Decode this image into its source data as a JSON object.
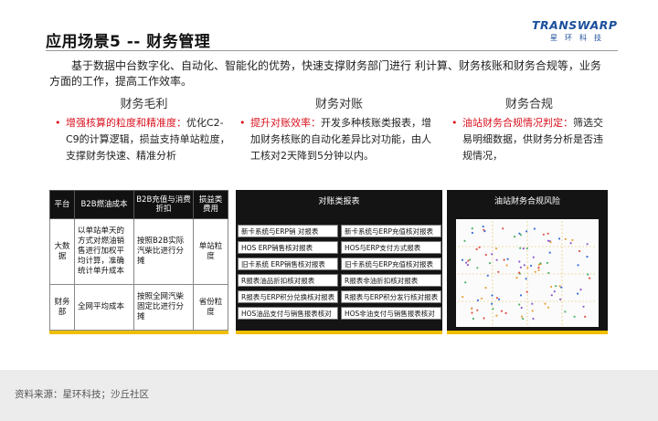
{
  "header": {
    "title": "应用场景5 -- 财务管理",
    "logo_brand": "TRANSWARP",
    "logo_sub": "星环科技"
  },
  "intro": "基于数据中台数字化、自动化、智能化的优势，快速支撑财务部门进行 利计算、财务核账和财务合规等，业务方面的工作，提高工作效率。",
  "columns": [
    {
      "heading": "财务毛利",
      "highlight": "增强核算的粒度和精准度：",
      "text": "优化C2-C9的计算逻辑，损益支持单站粒度，支撑财务快速、精准分析"
    },
    {
      "heading": "财务对账",
      "highlight": "提升对账效率：",
      "text": "开发多种核账类报表，增加财务核账的自动化差异比对功能，由人工核对2天降到5分钟以内。"
    },
    {
      "heading": "财务合规",
      "highlight": "油站财务合规情况判定：",
      "text": "筛选交易明细数据，供财务分析是否违规情况，"
    }
  ],
  "table": {
    "headers": [
      "平台",
      "B2B燃油成本",
      "B2B充值与消费折扣",
      "损益类费用"
    ],
    "rows": [
      [
        "大数据",
        "以单站单天的方式对燃油销售进行加权平均计算，准确统计单升成本",
        "按照B2B实际汽柴比进行分摊",
        "单站粒度"
      ],
      [
        "财务部",
        "全网平均成本",
        "按照全网汽柴固定比进行分摊",
        "省份粒度"
      ]
    ]
  },
  "panel2": {
    "title": "对账类报表",
    "cells": [
      "新卡系统与ERP销 对报表",
      "新卡系统与ERP充值核对报表",
      "HOS ERP销售核对报表",
      "HOS与ERP支付方式报表",
      "旧卡系统 ERP销售核对报表",
      "旧卡系统与ERP充值核对报表",
      "R报表油品折扣核对报表",
      "R报表非油折扣核对报表",
      "R报表与ERP积分兑换核对报表",
      "R报表与ERP积分发行核对报表",
      "HOS油品支付与销售报表核对",
      "HOS非油支付与销售报表核对"
    ]
  },
  "panel3": {
    "title": "油站财务合规风险"
  },
  "footer": {
    "source": "资料来源：星环科技；沙丘社区"
  },
  "colors": {
    "highlight": "#d9121f",
    "accent_bar": "#f0be00",
    "panel_bg": "#141414",
    "brand": "#1b4f9c"
  }
}
